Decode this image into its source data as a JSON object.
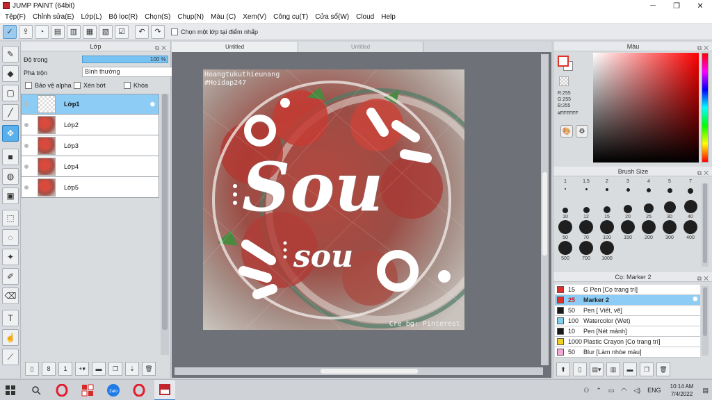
{
  "window": {
    "title": "JUMP PAINT (64bit)"
  },
  "menu": [
    "Tệp(F)",
    "Chỉnh sửa(E)",
    "Lớp(L)",
    "Bộ lọc(R)",
    "Chọn(S)",
    "Chụp(N)",
    "Màu (C)",
    "Xem(V)",
    "Công cụ(T)",
    "Cửa sổ(W)",
    "Cloud",
    "Help"
  ],
  "toolbar": {
    "select_on_click_label": "Chọn một lớp tại điểm nhấp"
  },
  "layer_panel": {
    "title": "Lớp",
    "opacity_label": "Độ trong",
    "opacity_value": "100 %",
    "opacity_percent": 100,
    "blend_label": "Pha trộn",
    "blend_value": "Bình thường",
    "protect_alpha": "Bảo vệ alpha",
    "clipping": "Xén bớt",
    "lock": "Khóa",
    "layers": [
      {
        "name": "Lớp1",
        "selected": true
      },
      {
        "name": "Lớp2",
        "selected": false
      },
      {
        "name": "Lớp3",
        "selected": false
      },
      {
        "name": "Lớp4",
        "selected": false
      },
      {
        "name": "Lớp5",
        "selected": false
      }
    ]
  },
  "document": {
    "tabs": [
      {
        "label": "Untitled",
        "active": true
      },
      {
        "label": "Untitled",
        "active": false
      }
    ],
    "canvas": {
      "watermark_top_line1": "Hoangtukuthieunang",
      "watermark_top_line2": "#Hoidap247",
      "watermark_bottom": "Cre bg: Pinterest",
      "art_text_main": "Sou",
      "art_text_sub": "sou"
    }
  },
  "color_panel": {
    "title": "Màu",
    "r": "R:255",
    "g": "G:255",
    "b": "B:255",
    "hex": "#FFFFFF",
    "foreground_color": "#FFFFFF",
    "accent_color": "#E0302A"
  },
  "brush_panel": {
    "title": "Brush Size",
    "sizes": [
      "1",
      "1.5",
      "2",
      "3",
      "4",
      "5",
      "7",
      "10",
      "12",
      "15",
      "20",
      "25",
      "30",
      "40",
      "50",
      "70",
      "100",
      "150",
      "200",
      "300",
      "400",
      "500",
      "700",
      "1000"
    ]
  },
  "tool_list": {
    "title": "Cọ: Marker 2",
    "items": [
      {
        "size": "15",
        "name": "G Pen [Cọ trang trí]",
        "color": "#E0302A",
        "selected": false
      },
      {
        "size": "25",
        "name": "Marker 2",
        "color": "#E0302A",
        "selected": true
      },
      {
        "size": "50",
        "name": "Pen [ Viết, vẽ]",
        "color": "#1A1A1A",
        "selected": false
      },
      {
        "size": "100",
        "name": "Watercolor (Wet)",
        "color": "#7ED0F0",
        "selected": false
      },
      {
        "size": "10",
        "name": "Pen [Nét mảnh]",
        "color": "#1A1A1A",
        "selected": false
      },
      {
        "size": "1000",
        "name": "Plastic Crayon [Cọ trang trí]",
        "color": "#F0D020",
        "selected": false
      },
      {
        "size": "50",
        "name": "Blur [Làm nhòe màu]",
        "color": "#F4A6D8",
        "selected": false
      }
    ]
  },
  "taskbar": {
    "language": "ENG",
    "time": "10:14 AM",
    "date": "7/4/2022"
  }
}
